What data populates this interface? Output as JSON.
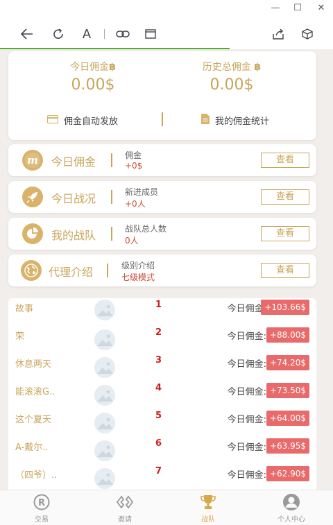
{
  "window": {
    "minimize_glyph": "—",
    "maximize_glyph": "☐",
    "close_glyph": "✕"
  },
  "toolbar": {
    "icons": [
      "back-arrow-icon",
      "refresh-icon",
      "text-size-icon",
      "link-icon",
      "reader-view-icon",
      "share-icon",
      "cube-icon"
    ],
    "text_size_glyph": "A",
    "load_progress": 0.69,
    "progress_color": "#4caf2e"
  },
  "summary": {
    "today": {
      "label": "今日佣金",
      "value": "0.00$"
    },
    "history": {
      "label": "历史总佣金",
      "value": "0.00$"
    },
    "auto_payout": "佣金自动发放",
    "my_stats": "我的佣金统计"
  },
  "stats": [
    {
      "title": "今日佣金",
      "key": "佣金",
      "value": "+0$",
      "button": "查看",
      "icon": "m-badge-icon"
    },
    {
      "title": "今日战况",
      "key": "新进成员",
      "value": "+0人",
      "button": "查看",
      "icon": "rocket-icon"
    },
    {
      "title": "我的战队",
      "key": "战队总人数",
      "value": "0人",
      "button": "查看",
      "icon": "pie-chart-icon"
    },
    {
      "title": "代理介绍",
      "key": "级别介绍",
      "value": "七级模式",
      "button": "查看",
      "icon": "globe-icon"
    }
  ],
  "leaderboard": [
    {
      "name": "故事",
      "rank": "1",
      "label": "今日佣金:",
      "amount": "+103.66$"
    },
    {
      "name": "荣",
      "rank": "2",
      "label": "今日佣金:",
      "amount": "+88.00$"
    },
    {
      "name": "休息两天",
      "rank": "3",
      "label": "今日佣金:",
      "amount": "+74.20$"
    },
    {
      "name": "能滚滚G..",
      "rank": "4",
      "label": "今日佣金:",
      "amount": "+73.50$"
    },
    {
      "name": "这个夏天",
      "rank": "5",
      "label": "今日佣金:",
      "amount": "+64.00$"
    },
    {
      "name": "A-戴尔..",
      "rank": "6",
      "label": "今日佣金:",
      "amount": "+63.95$"
    },
    {
      "name": "（四爷）..",
      "rank": "7",
      "label": "今日佣金:",
      "amount": "+62.90$"
    }
  ],
  "bottom_nav": [
    {
      "label": "交易",
      "icon": "registered-icon",
      "active": false
    },
    {
      "label": "邀请",
      "icon": "link-diamond-icon",
      "active": false
    },
    {
      "label": "战队",
      "icon": "trophy-icon",
      "active": true
    },
    {
      "label": "个人中心",
      "icon": "user-icon",
      "active": false
    }
  ],
  "colors": {
    "accent": "#c9a55c",
    "badge": "#e86a6a",
    "rank": "#d01c1c",
    "active_nav": "#d6a94a"
  }
}
